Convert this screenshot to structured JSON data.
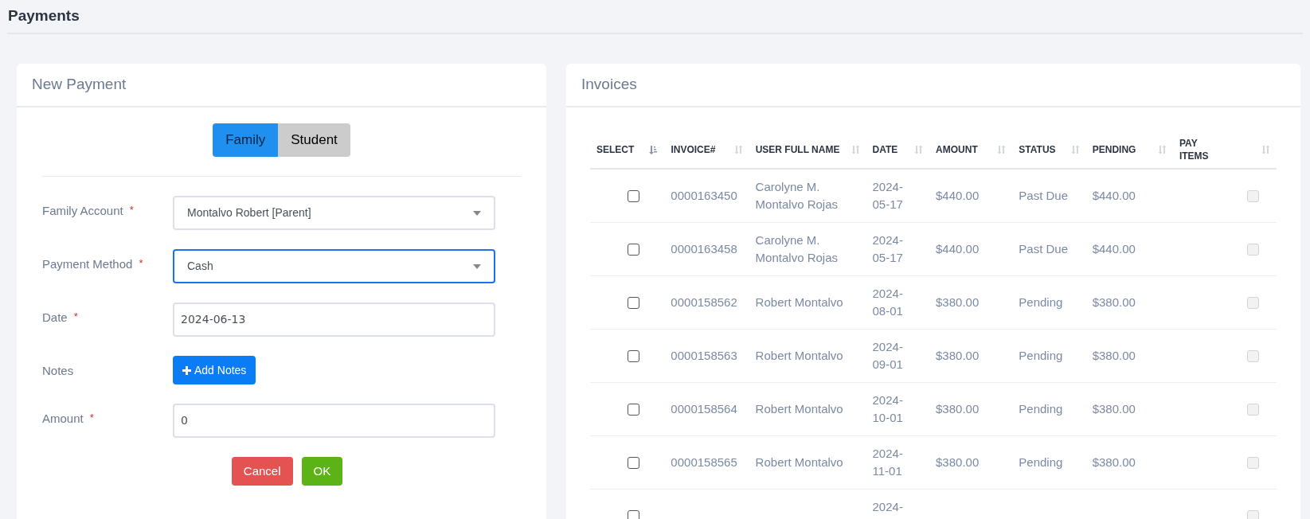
{
  "page_title": "Payments",
  "new_payment": {
    "title": "New Payment",
    "toggle": [
      {
        "label": "Family",
        "selected": true
      },
      {
        "label": "Student",
        "selected": false
      }
    ],
    "fields": [
      {
        "kind": "select",
        "label": "Family Account",
        "required": "*",
        "value": "Montalvo Robert [Parent]",
        "focused": false
      },
      {
        "kind": "select",
        "label": "Payment Method",
        "required": "*",
        "value": "Cash",
        "focused": true
      },
      {
        "kind": "input",
        "label": "Date",
        "required": "*",
        "value": "2024-06-13",
        "focused": false
      },
      {
        "kind": "button",
        "label": "Notes",
        "button": "Add Notes"
      },
      {
        "kind": "input",
        "label": "Amount",
        "required": "*",
        "value": "0",
        "focused": false
      }
    ],
    "actions": [
      {
        "kind": "cancel",
        "label": "Cancel"
      },
      {
        "kind": "ok",
        "label": "OK"
      }
    ]
  },
  "invoices": {
    "title": "Invoices",
    "columns": [
      {
        "label": "SELECT",
        "sorted": true
      },
      {
        "label": "INVOICE#",
        "sorted": false
      },
      {
        "label": "USER FULL NAME",
        "sorted": false
      },
      {
        "label": "DATE",
        "sorted": false
      },
      {
        "label": "AMOUNT",
        "sorted": false
      },
      {
        "label": "STATUS",
        "sorted": false
      },
      {
        "label": "PENDING",
        "sorted": false
      },
      {
        "label": "PAY ITEMS",
        "sorted": false
      }
    ],
    "rows": [
      {
        "checked": false,
        "invoice": "0000163450",
        "name": "Carolyne M. Montalvo Rojas",
        "date": "2024-05-17",
        "amount": "$440.00",
        "status": "Past Due",
        "pending": "$440.00",
        "pay_items_checked": false
      },
      {
        "checked": false,
        "invoice": "0000163458",
        "name": "Carolyne M. Montalvo Rojas",
        "date": "2024-05-17",
        "amount": "$440.00",
        "status": "Past Due",
        "pending": "$440.00",
        "pay_items_checked": false
      },
      {
        "checked": false,
        "invoice": "0000158562",
        "name": "Robert Montalvo",
        "date": "2024-08-01",
        "amount": "$380.00",
        "status": "Pending",
        "pending": "$380.00",
        "pay_items_checked": false
      },
      {
        "checked": false,
        "invoice": "0000158563",
        "name": "Robert Montalvo",
        "date": "2024-09-01",
        "amount": "$380.00",
        "status": "Pending",
        "pending": "$380.00",
        "pay_items_checked": false
      },
      {
        "checked": false,
        "invoice": "0000158564",
        "name": "Robert Montalvo",
        "date": "2024-10-01",
        "amount": "$380.00",
        "status": "Pending",
        "pending": "$380.00",
        "pay_items_checked": false
      },
      {
        "checked": false,
        "invoice": "0000158565",
        "name": "Robert Montalvo",
        "date": "2024-11-01",
        "amount": "$380.00",
        "status": "Pending",
        "pending": "$380.00",
        "pay_items_checked": false
      },
      {
        "checked": false,
        "date": "2024-",
        "pay_items_checked": false
      }
    ]
  }
}
